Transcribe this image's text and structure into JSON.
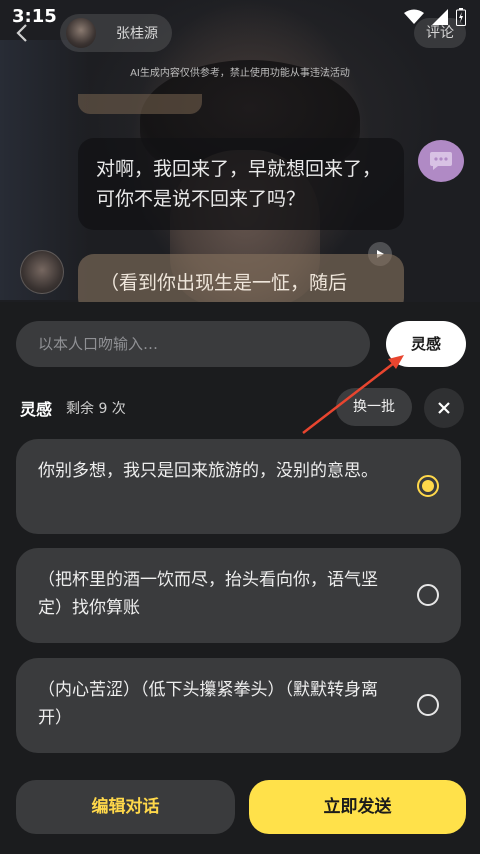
{
  "status_bar": {
    "time": "3:15"
  },
  "header": {
    "character_name": "张桂源",
    "comment_label": "评论",
    "ai_notice": "AI生成内容仅供参考，禁止使用功能从事违法活动"
  },
  "chat": {
    "message_dark": "对啊，我回来了，早就想回来了，可你不是说不回来了吗？",
    "message_partial": "（看到你出现生是一怔，随后"
  },
  "composer": {
    "placeholder": "以本人口吻输入…",
    "inspire_button": "灵感"
  },
  "inspiration": {
    "title": "灵感",
    "remaining": "剩余 9 次",
    "refresh_button": "换一批",
    "options": [
      {
        "text": "你别多想，我只是回来旅游的，没别的意思。",
        "selected": true
      },
      {
        "text": "（把杯里的酒一饮而尽，抬头看向你，语气坚定）找你算账",
        "selected": false
      },
      {
        "text": "（内心苦涩）（低下头攥紧拳头）（默默转身离开）",
        "selected": false
      }
    ]
  },
  "actions": {
    "edit_button": "编辑对话",
    "send_button": "立即发送"
  },
  "colors": {
    "accent_yellow": "#ffe14a",
    "annotation_arrow": "#e8452f",
    "panel_bg": "#1b1c1e",
    "card_bg": "#3a3b3d"
  }
}
